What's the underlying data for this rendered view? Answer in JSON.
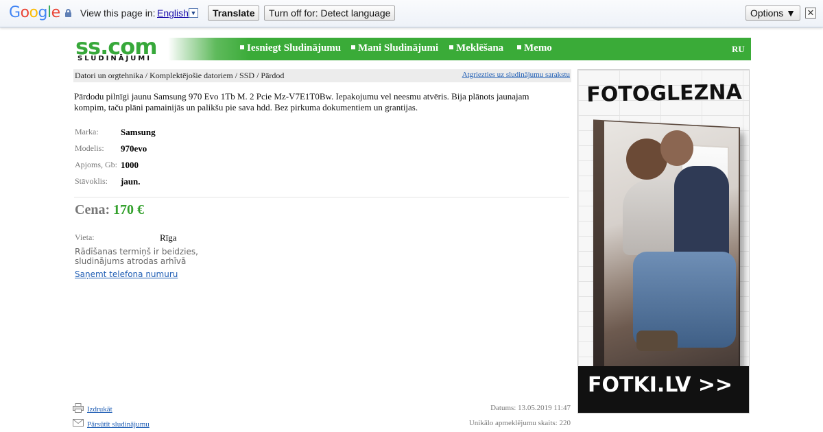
{
  "translate_bar": {
    "logo": "Google",
    "view_text": "View this page in:",
    "language": "English",
    "translate_button": "Translate",
    "turn_off_button": "Turn off for: Detect language",
    "options_button": "Options ▼",
    "close_symbol": "✕"
  },
  "header": {
    "logo_main": "ss.com",
    "logo_sub": "SLUDINĀJUMI",
    "nav": [
      "Iesniegt Sludinājumu",
      "Mani Sludinājumi",
      "Meklēšana",
      "Memo"
    ],
    "lang_link": "RU"
  },
  "breadcrumb": {
    "path": "Datori un orgtehnika / Komplektējošie datoriem / SSD / Pārdod",
    "back_link": "Atgriezties uz sludinājumu sarakstu"
  },
  "listing": {
    "description": "Pārdodu pilnīgi jaunu Samsung 970 Evo 1Tb M. 2 Pcie Mz-V7E1T0Bw. Iepakojumu vel neesmu atvēris. Bija plānots jaunajam kompim, taču plāni pamainijās un palikšu pie sava hdd. Bez pirkuma dokumentiem un grantijas.",
    "properties": [
      {
        "label": "Marka:",
        "value": "Samsung"
      },
      {
        "label": "Modelis:",
        "value": "970evo"
      },
      {
        "label": "Apjoms, Gb:",
        "value": "1000"
      },
      {
        "label": "Stāvoklis:",
        "value": "jaun."
      }
    ],
    "price_label": "Cena:",
    "price_value": "170 €",
    "location_label": "Vieta:",
    "location_value": "Rīga",
    "expired_note": "Rādīšanas termiņš ir beidzies, sludinājums atrodas arhīvā",
    "phone_link": "Saņemt telefona numuru"
  },
  "footer": {
    "print_link": "Izdrukāt",
    "send_link": "Pārsūtīt sludinājumu",
    "date": "Datums: 13.05.2019 11:47",
    "views": "Unikālo apmeklējumu skaits: 220"
  },
  "ad": {
    "title": "FOTOGLEZNA",
    "brand": "FOTKI.LV >>"
  },
  "colors": {
    "accent_green": "#3aab38",
    "link_blue": "#1e5db4",
    "price_green": "#33a02c"
  }
}
